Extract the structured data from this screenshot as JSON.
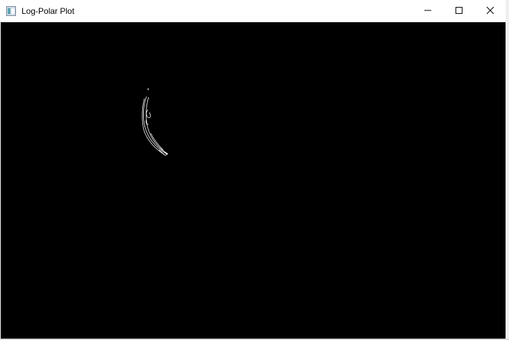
{
  "window": {
    "title": "Log-Polar Plot",
    "background": "#000000",
    "curve_color": "#ffffff"
  },
  "icons": {
    "app": "app-window-icon",
    "minimize": "minimize-icon",
    "maximize": "maximize-icon",
    "close": "close-icon"
  }
}
